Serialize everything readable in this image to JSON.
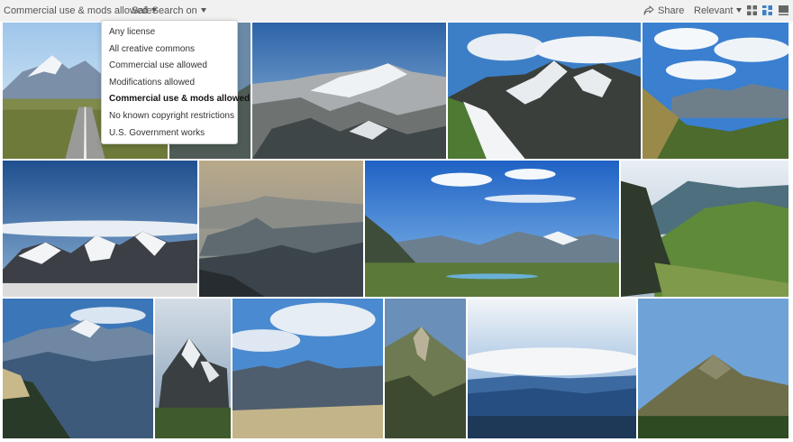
{
  "toolbar": {
    "license_label": "Commercial use & mods allowed",
    "safesearch_label": "SafeSearch on",
    "share_label": "Share",
    "sort_label": "Relevant",
    "icons": [
      "share-icon",
      "grid-small-icon",
      "grid-medium-icon",
      "grid-large-icon"
    ],
    "accent_color": "#3b82c4"
  },
  "license_menu": {
    "selected": "Commercial use & mods allowed",
    "options": [
      "Any license",
      "All creative commons",
      "Commercial use allowed",
      "Modifications allowed",
      "Commercial use & mods allowed",
      "No known copyright restrictions",
      "U.S. Government works"
    ]
  },
  "results": {
    "rows": [
      [
        "mountain road with snowy peaks",
        "partially hidden mountain",
        "snowy ridge panorama",
        "snow-streaked rocky peak",
        "green slopes under blue sky"
      ],
      [
        "snowy range above clouds",
        "hazy layered mountain silhouettes",
        "alpine valley with lake",
        "green valley with cliffs"
      ],
      [
        "blue mountain ranges",
        "snowy pyramid peak",
        "dark ridge under clouds",
        "green ridge path",
        "peaks above sea of clouds",
        "brown peak with trees"
      ]
    ]
  }
}
